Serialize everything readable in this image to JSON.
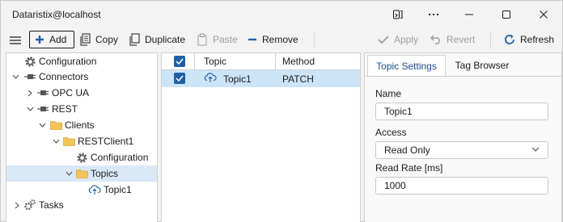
{
  "window": {
    "title": "Dataristix@localhost"
  },
  "toolbar": {
    "add_label": "Add",
    "copy_label": "Copy",
    "duplicate_label": "Duplicate",
    "paste_label": "Paste",
    "remove_label": "Remove",
    "apply_label": "Apply",
    "revert_label": "Revert",
    "refresh_label": "Refresh"
  },
  "tree": {
    "items": [
      {
        "label": "Configuration",
        "icon": "gear-icon"
      },
      {
        "label": "Connectors",
        "icon": "plug-icon"
      },
      {
        "label": "OPC UA",
        "icon": "plug-icon"
      },
      {
        "label": "REST",
        "icon": "plug-icon"
      },
      {
        "label": "Clients",
        "icon": "folder-icon"
      },
      {
        "label": "RESTClient1",
        "icon": "folder-icon"
      },
      {
        "label": "Configuration",
        "icon": "gear-icon"
      },
      {
        "label": "Topics",
        "icon": "folder-icon"
      },
      {
        "label": "Topic1",
        "icon": "cloud-upload-icon"
      },
      {
        "label": "Tasks",
        "icon": "gears-icon"
      }
    ]
  },
  "grid": {
    "columns": {
      "topic": "Topic",
      "method": "Method"
    },
    "rows": [
      {
        "topic": "Topic1",
        "method": "PATCH",
        "checked": true
      }
    ]
  },
  "props": {
    "tabs": [
      {
        "label": "Topic Settings",
        "active": true
      },
      {
        "label": "Tag Browser",
        "active": false
      }
    ],
    "name_label": "Name",
    "name_value": "Topic1",
    "access_label": "Access",
    "access_value": "Read Only",
    "rate_label": "Read Rate [ms]",
    "rate_value": "1000"
  },
  "colors": {
    "accent": "#1f5fa8",
    "selection": "#cce4f7",
    "folder": "#f2c55c"
  }
}
